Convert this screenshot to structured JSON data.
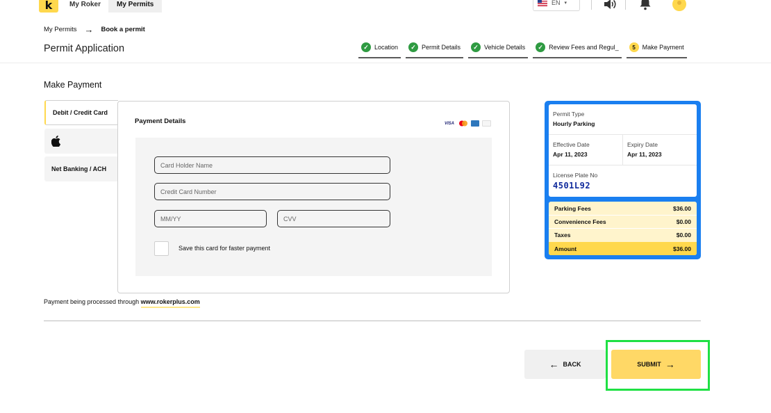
{
  "nav": {
    "logo_letter": "k",
    "tabs": [
      "My Roker",
      "My Permits"
    ],
    "language": "EN",
    "notification_count": "",
    "icons": [
      "flag-us-icon",
      "chevron-down-icon",
      "speaker-icon",
      "bell-icon",
      "user-avatar-icon"
    ]
  },
  "breadcrumb": {
    "parent": "My Permits",
    "current": "Book a permit"
  },
  "page_title": "Permit Application",
  "steps": [
    {
      "label": "Location",
      "status": "done"
    },
    {
      "label": "Permit Details",
      "status": "done"
    },
    {
      "label": "Vehicle Details",
      "status": "done"
    },
    {
      "label": "Review Fees and Regul_",
      "status": "done"
    },
    {
      "label": "Make Payment",
      "status": "current",
      "number": "5"
    }
  ],
  "section_title": "Make Payment",
  "payment_methods": [
    "Debit / Credit Card",
    "",
    "Net Banking / ACH"
  ],
  "payment_details": {
    "title": "Payment Details",
    "card_brands": [
      "VISA",
      "MC",
      "AMEX",
      "DISC"
    ],
    "placeholders": {
      "card_holder": "Card Holder Name",
      "card_number": "Credit Card Number",
      "expiry": "MM/YY",
      "cvv": "CVV"
    },
    "save_card_label": "Save this card for faster payment"
  },
  "summary": {
    "permit_type_label": "Permit Type",
    "permit_type": "Hourly Parking",
    "effective_label": "Effective Date",
    "effective_date": "Apr 11, 2023",
    "expiry_label": "Expiry Date",
    "expiry_date": "Apr 11, 2023",
    "plate_label": "License Plate No",
    "plate": "4501L92",
    "fees": [
      {
        "label": "Parking Fees",
        "value": "$36.00"
      },
      {
        "label": "Convenience Fees",
        "value": "$0.00"
      },
      {
        "label": "Taxes",
        "value": "$0.00"
      }
    ],
    "total_label": "Amount",
    "total_value": "$36.00"
  },
  "processed": {
    "prefix": "Payment being processed through",
    "link": "www.rokerplus.com"
  },
  "buttons": {
    "back": "BACK",
    "submit": "SUBMIT"
  },
  "colors": {
    "accent": "#ffd84d",
    "summary_border": "#1a7ff0",
    "step_done": "#2f9b42",
    "highlight": "#1fe044"
  }
}
